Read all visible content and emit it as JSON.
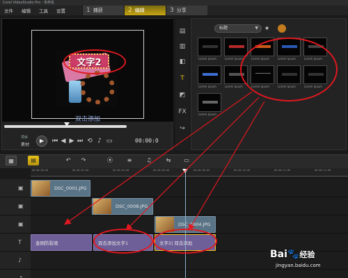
{
  "window": {
    "title": "Corel VideoStudio Pro - 未命名"
  },
  "menu": [
    "文件",
    "编辑",
    "工具",
    "设置"
  ],
  "steps": [
    {
      "num": "1",
      "label": "捕获"
    },
    {
      "num": "2",
      "label": "编辑"
    },
    {
      "num": "3",
      "label": "分享"
    }
  ],
  "preview": {
    "overlay_title": "文字2",
    "caption": "双击添加",
    "label_project": "项目",
    "label_source": "素材",
    "timecode": "00:00:0"
  },
  "library": {
    "category": "标题",
    "thumbnails": [
      {
        "caption": "Lorem ipsum",
        "style": "dark"
      },
      {
        "caption": "Lorem ipsum",
        "style": "red"
      },
      {
        "caption": "Lorem ipsum",
        "style": "orange"
      },
      {
        "caption": "Lorem ipsum",
        "style": "blue"
      },
      {
        "caption": "Lorem ipsum",
        "style": "dark"
      },
      {
        "caption": "Lorem ipsum",
        "style": "bluebar"
      },
      {
        "caption": "Lorem ipsum",
        "style": "dots"
      },
      {
        "caption": "Lorem ipsum",
        "style": "red"
      },
      {
        "caption": "Lorem ipsum",
        "style": "dark"
      },
      {
        "caption": "Lorem ipsum",
        "style": "dark"
      },
      {
        "caption": "Lorem ipsum",
        "style": "dark"
      }
    ]
  },
  "ruler": [
    "00:00:00:00",
    "00:00:02:00",
    "00:00:04:00",
    "00:00:06:00",
    "00:00:08:00",
    "00:00:10:00",
    "00:00:12:00",
    "00:00:14:00"
  ],
  "tracks": {
    "video": {
      "clip": "DSC_0001.JPG"
    },
    "overlay1": {
      "clip": "DSC_0008.JPG"
    },
    "overlay2": {
      "clip": "DSC_0004.JPG"
    },
    "title": [
      {
        "label": "金刚防裂液"
      },
      {
        "label": "双击添加文字1"
      },
      {
        "label": "文字2| 双击添加"
      }
    ]
  },
  "watermark": {
    "logo": "Bai",
    "logo2": "经验",
    "url": "jingyan.baidu.com"
  },
  "colors": {
    "accent": "#e8c21a",
    "annotation": "#e2181f",
    "video_clip": "#5a7487",
    "title_clip": "#6e5f98"
  }
}
